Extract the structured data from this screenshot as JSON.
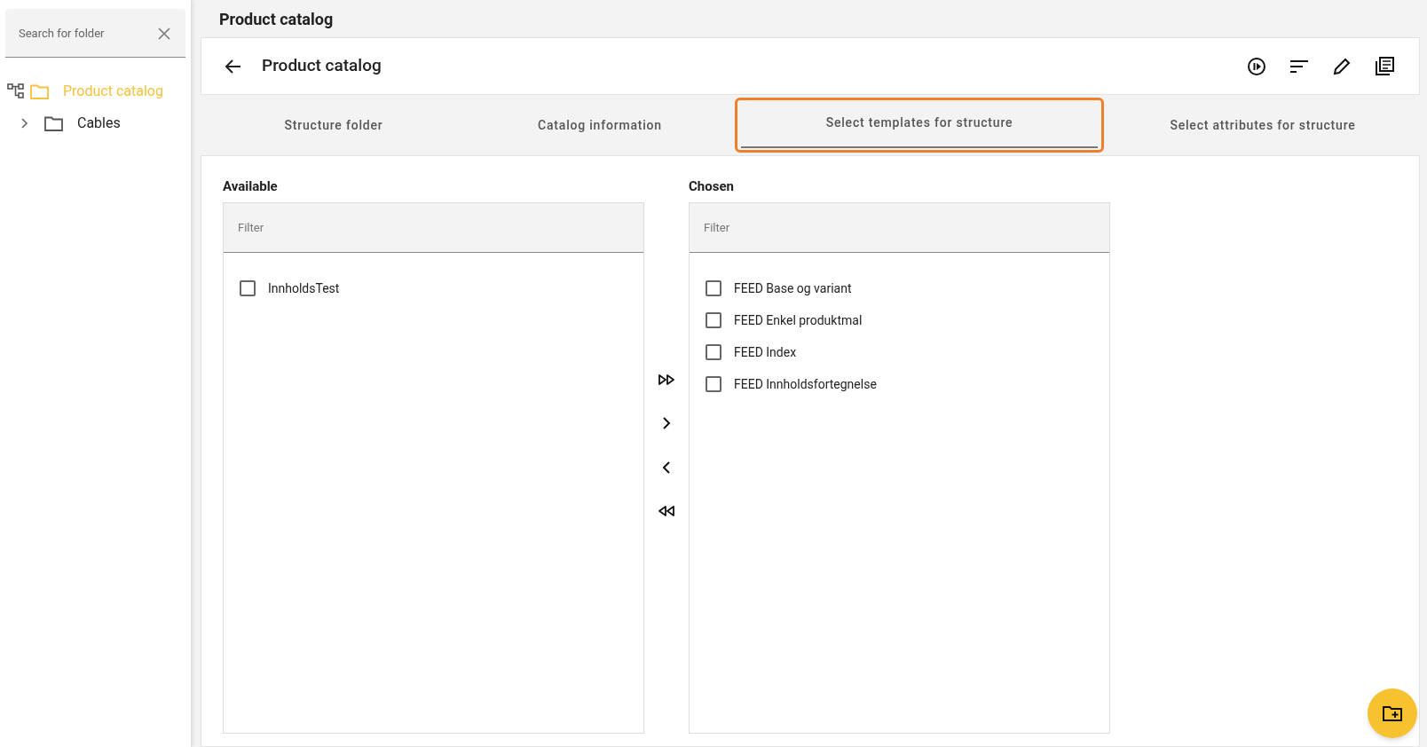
{
  "sidebar": {
    "search": {
      "placeholder": "Search for folder"
    },
    "tree": [
      {
        "label": "Product catalog",
        "selected": true,
        "children": [
          {
            "label": "Cables",
            "selected": false,
            "expanded": false
          }
        ]
      }
    ]
  },
  "page_title": "Product catalog",
  "header": {
    "title": "Product catalog"
  },
  "tabs": [
    {
      "label": "Structure folder",
      "selected": false
    },
    {
      "label": "Catalog information",
      "selected": false
    },
    {
      "label": "Select templates for structure",
      "selected": true
    },
    {
      "label": "Select attributes for structure",
      "selected": false
    }
  ],
  "available": {
    "title": "Available",
    "filter": {
      "placeholder": "Filter"
    },
    "items": [
      {
        "label": "InnholdsTest",
        "checked": false
      }
    ]
  },
  "chosen": {
    "title": "Chosen",
    "filter": {
      "placeholder": "Filter"
    },
    "items": [
      {
        "label": "FEED Base og variant",
        "checked": false
      },
      {
        "label": "FEED Enkel produktmal",
        "checked": false
      },
      {
        "label": "FEED Index",
        "checked": false
      },
      {
        "label": "FEED Innholdsfortegnelse",
        "checked": false
      }
    ]
  }
}
